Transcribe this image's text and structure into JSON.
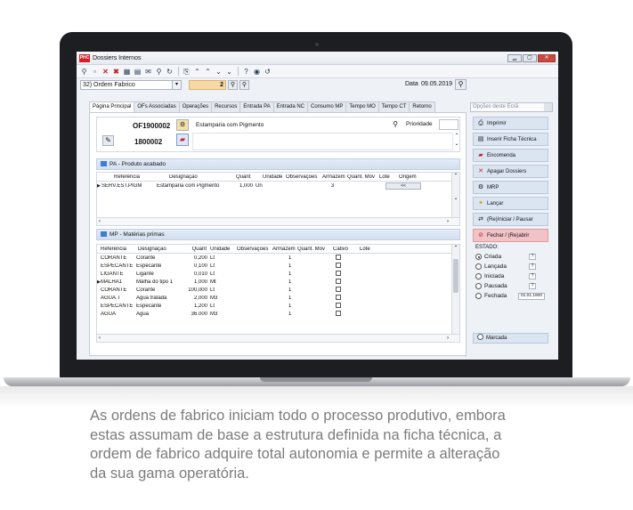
{
  "window": {
    "logo": "PHC",
    "title": "Dossiers Internos",
    "controls": [
      "▁",
      "▢",
      "✕"
    ]
  },
  "toolbar": {
    "icons": [
      "magnifier-dropdown-icon",
      "new-document-icon",
      "delete-icon",
      "delete-alt-icon",
      "grid-icon",
      "table-icon",
      "email-icon",
      "search-icon",
      "refresh-icon",
      "preview-icon",
      "first-icon",
      "prev-icon",
      "next-icon",
      "last-icon",
      "help-icon",
      "settings-icon",
      "reload-icon"
    ]
  },
  "header": {
    "doc_type": "32) Ordem Fabrico",
    "number": "2",
    "date_label": "Data",
    "date_value": "09.05.2019"
  },
  "tabs": [
    "Página Principal",
    "OFs Associadas",
    "Operações",
    "Recursos",
    "Entrada PA",
    "Entrada NC",
    "Consumo MP",
    "Tempo MO",
    "Tempo CT",
    "Retorno"
  ],
  "right_combo_placeholder": "Opções deste Ecrã",
  "of": {
    "code": "OF1900002",
    "number": "1800002",
    "description": "Estamparia com Pigmento",
    "priority_label": "Prioridade"
  },
  "pa": {
    "title": "PA - Produto acabado",
    "columns": [
      "Referência",
      "Designação",
      "Quant",
      "Unidade",
      "Observações",
      "Armazem",
      "Quant. Mov",
      "Lote",
      "Origem"
    ],
    "rows": [
      {
        "ref": "SERV.EST.PIGM",
        "des": "Estamparia com Pigmento",
        "quant": "1,000",
        "unit": "Un",
        "obs": "",
        "arm": "3",
        "qmov": "",
        "lote": "",
        "origem": "<<"
      }
    ]
  },
  "mp": {
    "title": "MP - Matérias primas",
    "columns": [
      "Referência",
      "Designação",
      "Quant",
      "Unidade",
      "Observações",
      "Armazem",
      "Quant. Mov",
      "Cativo",
      "Lote"
    ],
    "rows": [
      {
        "ref": "CORANTE",
        "des": "Corante",
        "quant": "0,200",
        "unit": "Lt",
        "arm": "1"
      },
      {
        "ref": "ESPECANTE",
        "des": "Especante",
        "quant": "0,100",
        "unit": "Lt",
        "arm": "1"
      },
      {
        "ref": "LIGANTE",
        "des": "Ligante",
        "quant": "0,010",
        "unit": "Lt",
        "arm": "1"
      },
      {
        "ref": "MALHA1",
        "des": "Malha do tipo 1",
        "quant": "1,000",
        "unit": "Mt",
        "arm": "1"
      },
      {
        "ref": "CORANTE",
        "des": "Corante",
        "quant": "100,000",
        "unit": "Lt",
        "arm": "1"
      },
      {
        "ref": "AGUA.T",
        "des": "Agua tratada",
        "quant": "2,000",
        "unit": "M3",
        "arm": "1"
      },
      {
        "ref": "ESPECANTE",
        "des": "Especante",
        "quant": "1,200",
        "unit": "Lt",
        "arm": "1"
      },
      {
        "ref": "AGUA",
        "des": "Agua",
        "quant": "36.000",
        "unit": "M3",
        "arm": "1"
      }
    ]
  },
  "side": {
    "buttons": [
      {
        "label": "Imprimir",
        "icon": "⎙"
      },
      {
        "label": "Inserir Ficha Técnica",
        "icon": "▤"
      },
      {
        "label": "Encomenda",
        "icon": "▰"
      },
      {
        "label": "Apagar Dossiers",
        "icon": "✕"
      },
      {
        "label": "MRP",
        "icon": "⚙"
      },
      {
        "label": "Lançar",
        "icon": "✦"
      },
      {
        "label": "(Re)Iniciar / Pausar",
        "icon": "⇄"
      },
      {
        "label": "Fechar / (Re)abrir",
        "icon": "⊘"
      }
    ],
    "estado_label": "ESTADO:",
    "states": [
      {
        "label": "Criada",
        "selected": true
      },
      {
        "label": "Lançada",
        "selected": false
      },
      {
        "label": "Iniciada",
        "selected": false
      },
      {
        "label": "Pausada",
        "selected": false
      },
      {
        "label": "Fechada",
        "selected": false
      }
    ],
    "qmark": "?",
    "fechada_date": "01.01.1900",
    "marcada": "Marcada"
  },
  "caption": "As ordens de fabrico iniciam todo o processo produtivo, embora estas assumam de base a estrutura definida na ficha técnica, a ordem de fabrico adquire total autonomia e permite a alteração da sua gama operatória.",
  "colors": {
    "accent_red": "#d4202a",
    "number_field": "#f6d9a5",
    "side_button": "#dbe5f2",
    "side_button_pink": "#f1c3c6",
    "caption_text": "#7c7c7c"
  }
}
